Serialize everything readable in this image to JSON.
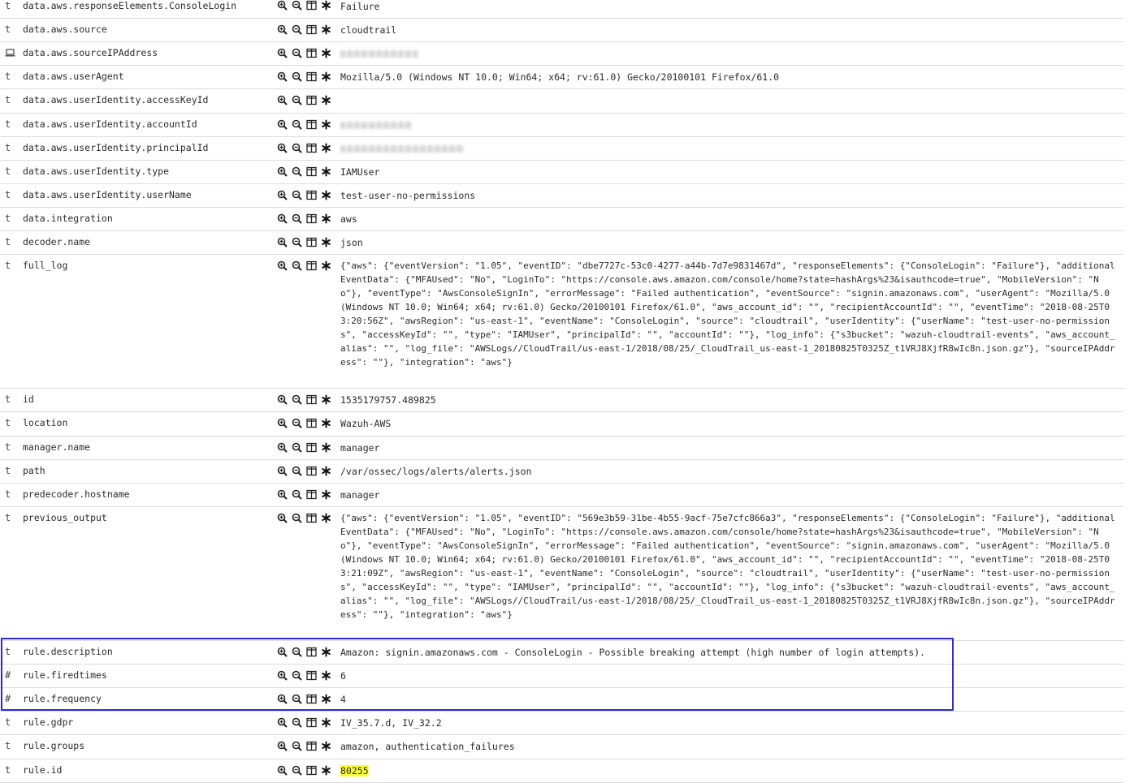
{
  "rows": [
    {
      "type": "t",
      "field": "data.aws.responseElements.ConsoleLogin",
      "value": "Failure"
    },
    {
      "type": "t",
      "field": "data.aws.source",
      "value": "cloudtrail"
    },
    {
      "type": "ip-icon",
      "field": "data.aws.sourceIPAddress",
      "value": ""
    },
    {
      "type": "t",
      "field": "data.aws.userAgent",
      "value": "Mozilla/5.0 (Windows NT 10.0; Win64; x64; rv:61.0) Gecko/20100101 Firefox/61.0"
    },
    {
      "type": "t",
      "field": "data.aws.userIdentity.accessKeyId",
      "value": ""
    },
    {
      "type": "t",
      "field": "data.aws.userIdentity.accountId",
      "value": ""
    },
    {
      "type": "t",
      "field": "data.aws.userIdentity.principalId",
      "value": ""
    },
    {
      "type": "t",
      "field": "data.aws.userIdentity.type",
      "value": "IAMUser"
    },
    {
      "type": "t",
      "field": "data.aws.userIdentity.userName",
      "value": "test-user-no-permissions"
    },
    {
      "type": "t",
      "field": "data.integration",
      "value": "aws"
    },
    {
      "type": "t",
      "field": "decoder.name",
      "value": "json"
    },
    {
      "type": "t",
      "field": "full_log",
      "value": "{\"aws\": {\"eventVersion\": \"1.05\", \"eventID\": \"dbe7727c-53c0-4277-a44b-7d7e9831467d\", \"responseElements\": {\"ConsoleLogin\": \"Failure\"}, \"additionalEventData\": {\"MFAUsed\": \"No\", \"LoginTo\": \"https://console.aws.amazon.com/console/home?state=hashArgs%23&isauthcode=true\", \"MobileVersion\": \"No\"}, \"eventType\": \"AwsConsoleSignIn\", \"errorMessage\": \"Failed authentication\", \"eventSource\": \"signin.amazonaws.com\", \"userAgent\": \"Mozilla/5.0 (Windows NT 10.0; Win64; x64; rv:61.0) Gecko/20100101 Firefox/61.0\", \"aws_account_id\": \"\", \"recipientAccountId\": \"\", \"eventTime\": \"2018-08-25T03:20:56Z\", \"awsRegion\": \"us-east-1\", \"eventName\": \"ConsoleLogin\", \"source\": \"cloudtrail\", \"userIdentity\": {\"userName\": \"test-user-no-permissions\", \"accessKeyId\": \"\", \"type\": \"IAMUser\", \"principalId\": \"\", \"accountId\": \"\"}, \"log_info\": {\"s3bucket\": \"wazuh-cloudtrail-events\", \"aws_account_alias\": \"\", \"log_file\": \"AWSLogs//CloudTrail/us-east-1/2018/08/25/_CloudTrail_us-east-1_20180825T0325Z_t1VRJ8XjfR8wIc8n.json.gz\"}, \"sourceIPAddress\": \"\"}, \"integration\": \"aws\"}"
    },
    {
      "type": "t",
      "field": "id",
      "value": "1535179757.489825"
    },
    {
      "type": "t",
      "field": "location",
      "value": "Wazuh-AWS"
    },
    {
      "type": "t",
      "field": "manager.name",
      "value": "manager"
    },
    {
      "type": "t",
      "field": "path",
      "value": "/var/ossec/logs/alerts/alerts.json"
    },
    {
      "type": "t",
      "field": "predecoder.hostname",
      "value": "manager"
    },
    {
      "type": "t",
      "field": "previous_output",
      "value": "{\"aws\": {\"eventVersion\": \"1.05\", \"eventID\": \"569e3b59-31be-4b55-9acf-75e7cfc866a3\", \"responseElements\": {\"ConsoleLogin\": \"Failure\"}, \"additionalEventData\": {\"MFAUsed\": \"No\", \"LoginTo\": \"https://console.aws.amazon.com/console/home?state=hashArgs%23&isauthcode=true\", \"MobileVersion\": \"No\"}, \"eventType\": \"AwsConsoleSignIn\", \"errorMessage\": \"Failed authentication\", \"eventSource\": \"signin.amazonaws.com\", \"userAgent\": \"Mozilla/5.0 (Windows NT 10.0; Win64; x64; rv:61.0) Gecko/20100101 Firefox/61.0\", \"aws_account_id\": \"\", \"recipientAccountId\": \"\", \"eventTime\": \"2018-08-25T03:21:09Z\", \"awsRegion\": \"us-east-1\", \"eventName\": \"ConsoleLogin\", \"source\": \"cloudtrail\", \"userIdentity\": {\"userName\": \"test-user-no-permissions\", \"accessKeyId\": \"\", \"type\": \"IAMUser\", \"principalId\": \"\", \"accountId\": \"\"}, \"log_info\": {\"s3bucket\": \"wazuh-cloudtrail-events\", \"aws_account_alias\": \"\", \"log_file\": \"AWSLogs//CloudTrail/us-east-1/2018/08/25/_CloudTrail_us-east-1_20180825T0325Z_t1VRJ8XjfR8wIc8n.json.gz\"}, \"sourceIPAddress\": \"\"}, \"integration\": \"aws\"}"
    },
    {
      "type": "t",
      "field": "rule.description",
      "value": "Amazon: signin.amazonaws.com - ConsoleLogin - Possible breaking attempt (high number of login attempts)."
    },
    {
      "type": "#",
      "field": "rule.firedtimes",
      "value": "6"
    },
    {
      "type": "#",
      "field": "rule.frequency",
      "value": "4"
    },
    {
      "type": "t",
      "field": "rule.gdpr",
      "value": "IV_35.7.d, IV_32.2"
    },
    {
      "type": "t",
      "field": "rule.groups",
      "value": "amazon, authentication_failures"
    },
    {
      "type": "t",
      "field": "rule.id",
      "value": "80255"
    }
  ],
  "row_actions": [
    "zoom-in-icon",
    "zoom-out-icon",
    "toggle-column-icon",
    "filter-exists-icon"
  ],
  "colors": {
    "highlight": "#ffff33",
    "selection_box": "#2b2bd6"
  }
}
